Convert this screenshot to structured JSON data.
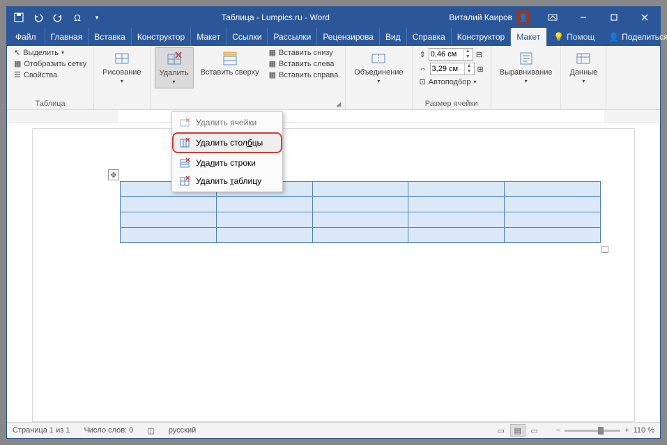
{
  "title": "Таблица - Lumpics.ru - Word",
  "user": {
    "name": "Виталий Каиров"
  },
  "tabs": {
    "file": "Файл",
    "items": [
      "Главная",
      "Вставка",
      "Конструктор",
      "Макет",
      "Ссылки",
      "Рассылки",
      "Рецензирова",
      "Вид",
      "Справка",
      "Конструктор",
      "Макет"
    ],
    "active_index": 10,
    "tellme": "Помощ",
    "share": "Поделиться"
  },
  "ribbon": {
    "table_group": {
      "label": "Таблица",
      "select": "Выделить",
      "gridlines": "Отобразить сетку",
      "properties": "Свойства"
    },
    "draw_group": {
      "label": "",
      "draw": "Рисование"
    },
    "rows_cols_group": {
      "label": "",
      "delete": "Удалить",
      "insert_above": "Вставить сверху",
      "insert_below": "Вставить снизу",
      "insert_left": "Вставить слева",
      "insert_right": "Вставить справа"
    },
    "merge_group": {
      "label": "",
      "merge": "Объединение"
    },
    "cellsize_group": {
      "label": "Размер ячейки",
      "height": "0,46 см",
      "width": "3,29 см",
      "autofit": "Автоподбор"
    },
    "align_group": {
      "label": "",
      "align": "Выравнивание"
    },
    "data_group": {
      "label": "",
      "data": "Данные"
    }
  },
  "dropdown": {
    "delete_cells": "Удалить ячейки",
    "delete_columns": "Удалить столбцы",
    "delete_rows": "Удалить строки",
    "delete_table": "Удалить таблицу"
  },
  "status": {
    "page": "Страница 1 из 1",
    "words": "Число слов: 0",
    "lang": "русский",
    "zoom": "110 %"
  }
}
